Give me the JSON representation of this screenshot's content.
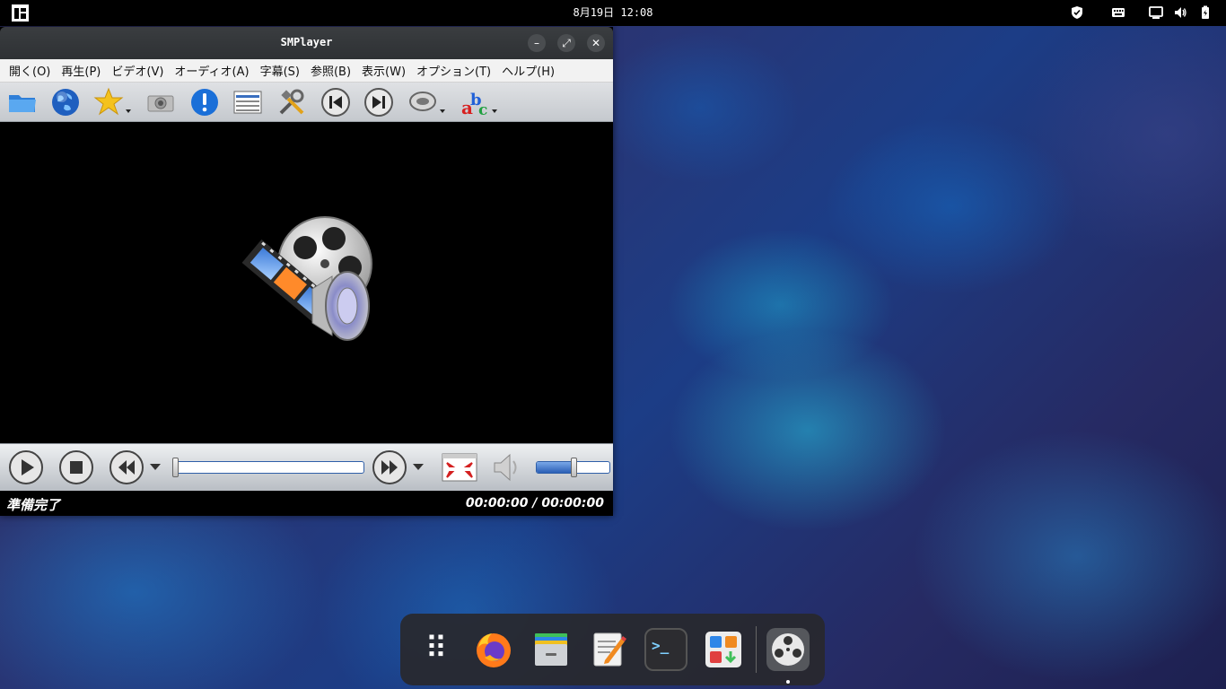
{
  "top_panel": {
    "clock": "8月19日 12:08",
    "icons": [
      "manjaro-logo-icon",
      "shield-icon",
      "keyboard-icon",
      "network-icon",
      "volume-icon",
      "battery-icon"
    ]
  },
  "window": {
    "title": "SMPlayer",
    "buttons": [
      "minimize-icon",
      "maximize-icon",
      "close-icon"
    ],
    "minimize_glyph": "–",
    "maximize_glyph": "⤢",
    "close_glyph": "✕",
    "menu": [
      "開く(O)",
      "再生(P)",
      "ビデオ(V)",
      "オーディオ(A)",
      "字幕(S)",
      "参照(B)",
      "表示(W)",
      "オプション(T)",
      "ヘルプ(H)"
    ],
    "toolbar_icons": [
      "open-folder-icon",
      "globe-icon",
      "favorites-star-icon",
      "screenshot-camera-icon",
      "info-icon",
      "playlist-icon",
      "preferences-tools-icon",
      "previous-icon",
      "next-icon",
      "audio-track-icon",
      "subtitles-abc-icon"
    ],
    "control_icons": [
      "play-icon",
      "stop-icon",
      "rewind-icon",
      "forward-icon",
      "fullscreen-icon",
      "speaker-icon"
    ],
    "progress": {
      "position_fraction": 0.0
    },
    "volume": {
      "level_fraction": 0.5
    },
    "status": "準備完了",
    "time": "00:00:00 / 00:00:00"
  },
  "dock": {
    "items": [
      "app-grid-icon",
      "firefox-icon",
      "file-manager-icon",
      "text-editor-icon",
      "terminal-icon",
      "software-center-icon",
      "smplayer-icon"
    ],
    "app_grid_glyph": "⠿",
    "terminal_glyph": ">_"
  },
  "colors": {
    "accent": "#2f5fa8",
    "panel": "#000000",
    "dock": "#28282c"
  }
}
